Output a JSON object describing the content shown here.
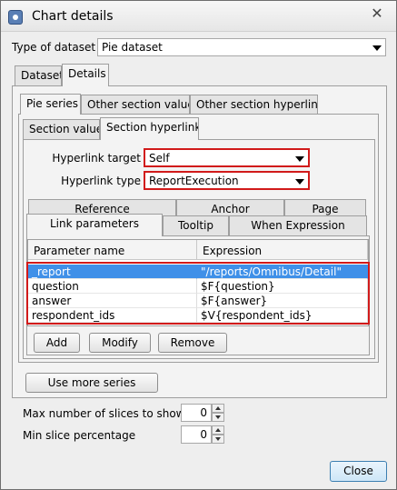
{
  "window": {
    "title": "Chart details",
    "close_glyph": "✕"
  },
  "dataset_type": {
    "label": "Type of dataset",
    "value": "Pie dataset"
  },
  "top_tabs": [
    {
      "label": "Dataset"
    },
    {
      "label": "Details"
    }
  ],
  "series_tabs": [
    {
      "label": "Pie series"
    },
    {
      "label": "Other section value"
    },
    {
      "label": "Other section hyperlink"
    }
  ],
  "section_tabs": [
    {
      "label": "Section value"
    },
    {
      "label": "Section hyperlink"
    }
  ],
  "hyperlink_target": {
    "label": "Hyperlink target",
    "value": "Self"
  },
  "hyperlink_type": {
    "label": "Hyperlink type",
    "value": "ReportExecution"
  },
  "param_tabs_row1": [
    {
      "label": "Reference"
    },
    {
      "label": "Anchor"
    },
    {
      "label": "Page"
    }
  ],
  "param_tabs_row2": [
    {
      "label": "Link parameters"
    },
    {
      "label": "Tooltip"
    },
    {
      "label": "When Expression"
    }
  ],
  "params_table": {
    "columns": [
      "Parameter name",
      "Expression"
    ],
    "rows": [
      {
        "name": "_report",
        "expr": "\"/reports/Omnibus/Detail\""
      },
      {
        "name": "question",
        "expr": "$F{question}"
      },
      {
        "name": "answer",
        "expr": "$F{answer}"
      },
      {
        "name": "respondent_ids",
        "expr": "$V{respondent_ids}"
      }
    ]
  },
  "buttons": {
    "add": "Add",
    "modify": "Modify",
    "remove": "Remove",
    "use_more_series": "Use more series",
    "close": "Close"
  },
  "max_slices": {
    "label": "Max number of slices to show",
    "value": "0"
  },
  "min_slice_pct": {
    "label": "Min slice percentage",
    "value": "0"
  },
  "colors": {
    "highlight_red": "#d11a1a",
    "selection_blue": "#3f90e8"
  }
}
